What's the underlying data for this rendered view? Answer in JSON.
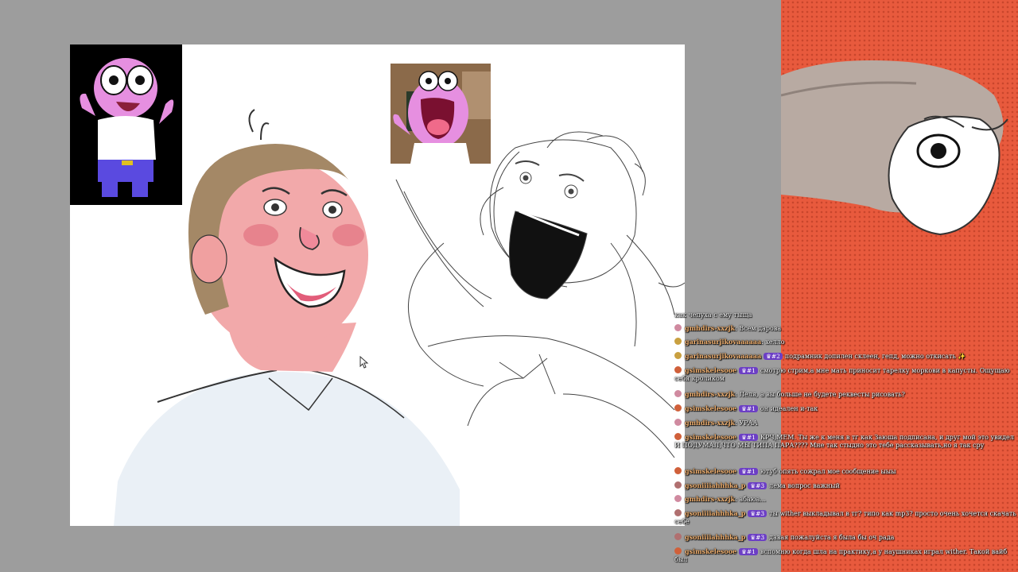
{
  "chat": {
    "messages": [
      {
        "user": "",
        "badge": "",
        "text": "как чепуха с ему тыща"
      },
      {
        "user": "gmhdirs-xxzjk",
        "badge": "",
        "text": "Всем дарова"
      },
      {
        "user": "garinasurjikovaaaaaa",
        "badge": "",
        "text": "хелло"
      },
      {
        "user": "garinasurjikovaaaaaa",
        "badge": "#2",
        "text": "подрамник допилен склеен, гепд, можно откисать ✨"
      },
      {
        "user": "gsimskelesooe",
        "badge": "#1",
        "text": "смотрю стрим,а мне мать приносит тарелку моркови в капусты. Ощущаю себя кроликом"
      },
      {
        "user": "gmhdirs-xxzjk",
        "badge": "",
        "text": "Леля, а вы больше не будете реквесты рисовать?"
      },
      {
        "user": "gsimskelesooe",
        "badge": "#1",
        "text": "он идеален и-так"
      },
      {
        "user": "gmhdirs-xxzjk",
        "badge": "",
        "text": "УРАА"
      },
      {
        "user": "gsimskelesooe",
        "badge": "#1",
        "text": "КРЧ,МЕМ. Ты же к меня в тг как Заюша подписана, и друг мой это увидел И ПОДУМАЛ,ЧТО МЫ ТИПА ПАРА???? Мне так стыдно это тебе рассказывать,но я так сру"
      },
      {
        "user": "gsimskelesooe",
        "badge": "#1",
        "text": "ютуб опять сожрал мое сообщение ыыы"
      },
      {
        "user": "gsoniiiiahhhka_p",
        "badge": "#3",
        "text": "лема вопрос важный"
      },
      {
        "user": "gmhdirs-xxzjk",
        "badge": "",
        "text": "абаюа..."
      },
      {
        "user": "gsoniiiiahhhka_p",
        "badge": "#3",
        "text": "ты wither выкладывал в тг? типо как mp3? просто очень хочется скачать себе"
      },
      {
        "user": "gsoniiiiahhhka_p",
        "badge": "#3",
        "text": "давая пожалуйста я была бы оч рада"
      },
      {
        "user": "gsimskelesooe",
        "badge": "#1",
        "text": "вспомню когда шла на практику,а у наушниках играл wither. Такой вайб был"
      }
    ]
  },
  "colors": {
    "stage_bg": "#9d9d9d",
    "canvas_bg": "#ffffff",
    "camera_bg": "#e85a3d",
    "username": "#f0b070",
    "badge_bg": "#6c3fc5",
    "skin": "#f2a9aa",
    "pink_character": "#e68fe0"
  },
  "icons": {
    "cursor": "arrow-cursor-icon",
    "crown": "crown-badge-icon"
  }
}
